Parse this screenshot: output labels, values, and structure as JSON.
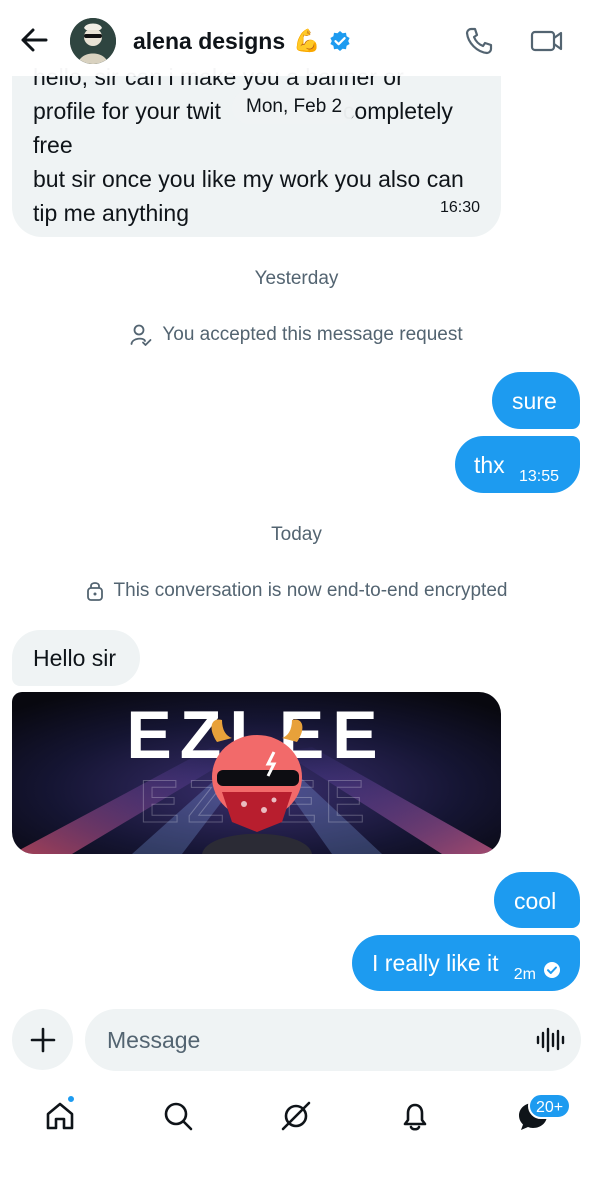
{
  "header": {
    "title": "alena designs",
    "title_emoji": "💪",
    "verified_icon": "verified-badge-icon",
    "back_icon": "arrow-left-icon",
    "call_icon": "phone-icon",
    "video_icon": "video-camera-icon"
  },
  "messages": {
    "first_incoming": {
      "line1": "hello, sir can i make you a banner or",
      "line2": "profile for your twit",
      "line2b": "completely",
      "line3": "free",
      "line4": "but sir once you like my work you also can",
      "line5": "tip me anything",
      "time": "16:30"
    },
    "date_pill": "Mon, Feb 2",
    "divider_yesterday": "Yesterday",
    "system_accepted": "You accepted this message request",
    "out_sure": "sure",
    "out_thx": "thx",
    "out_thx_time": "13:55",
    "divider_today": "Today",
    "system_encrypted": "This conversation is now end-to-end encrypted",
    "in_hello": "Hello sir",
    "banner_text": "EZLEE",
    "out_cool": "cool",
    "out_like": "I really like it",
    "out_like_time": "2m"
  },
  "composer": {
    "placeholder": "Message",
    "plus_icon": "plus-icon",
    "voice_icon": "voice-waveform-icon"
  },
  "nav": {
    "items": [
      "home-icon",
      "search-icon",
      "grok-icon",
      "bell-icon",
      "messages-icon"
    ],
    "messages_badge": "20+"
  },
  "colors": {
    "accent": "#1d9bf0",
    "incoming_bubble": "#eff3f4",
    "secondary_text": "#536471",
    "primary_text": "#0f1419"
  }
}
